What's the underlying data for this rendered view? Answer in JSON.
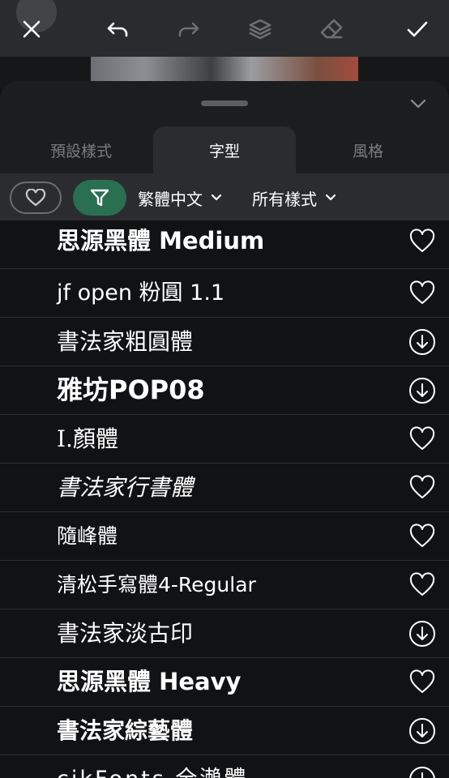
{
  "toolbar": {
    "icons": [
      "close-icon",
      "undo-icon",
      "redo-icon",
      "layers-icon",
      "eraser-icon",
      "check-icon"
    ]
  },
  "tabs": [
    {
      "label": "預設樣式",
      "active": false
    },
    {
      "label": "字型",
      "active": true
    },
    {
      "label": "風格",
      "active": false
    }
  ],
  "filters": {
    "language": "繁體中文",
    "style": "所有樣式",
    "accent_color": "#2a6f52"
  },
  "fonts": [
    {
      "name": "思源黑體 Medium",
      "action": "heart-icon"
    },
    {
      "name": "jf open 粉圓 1.1",
      "action": "heart-icon"
    },
    {
      "name": "書法家粗圓體",
      "action": "download-icon"
    },
    {
      "name": "雅坊POP08",
      "action": "download-icon"
    },
    {
      "name": "I.顏體",
      "action": "heart-icon"
    },
    {
      "name": "書法家行書體",
      "action": "heart-icon"
    },
    {
      "name": "隨峰體",
      "action": "heart-icon"
    },
    {
      "name": "清松手寫體4-Regular",
      "action": "heart-icon"
    },
    {
      "name": "書法家淡古印",
      "action": "download-icon"
    },
    {
      "name": "思源黑體 Heavy",
      "action": "heart-icon"
    },
    {
      "name": "書法家綜藝體",
      "action": "download-icon"
    },
    {
      "name": "cjkFonts 全瀨體",
      "action": "download-icon"
    }
  ]
}
